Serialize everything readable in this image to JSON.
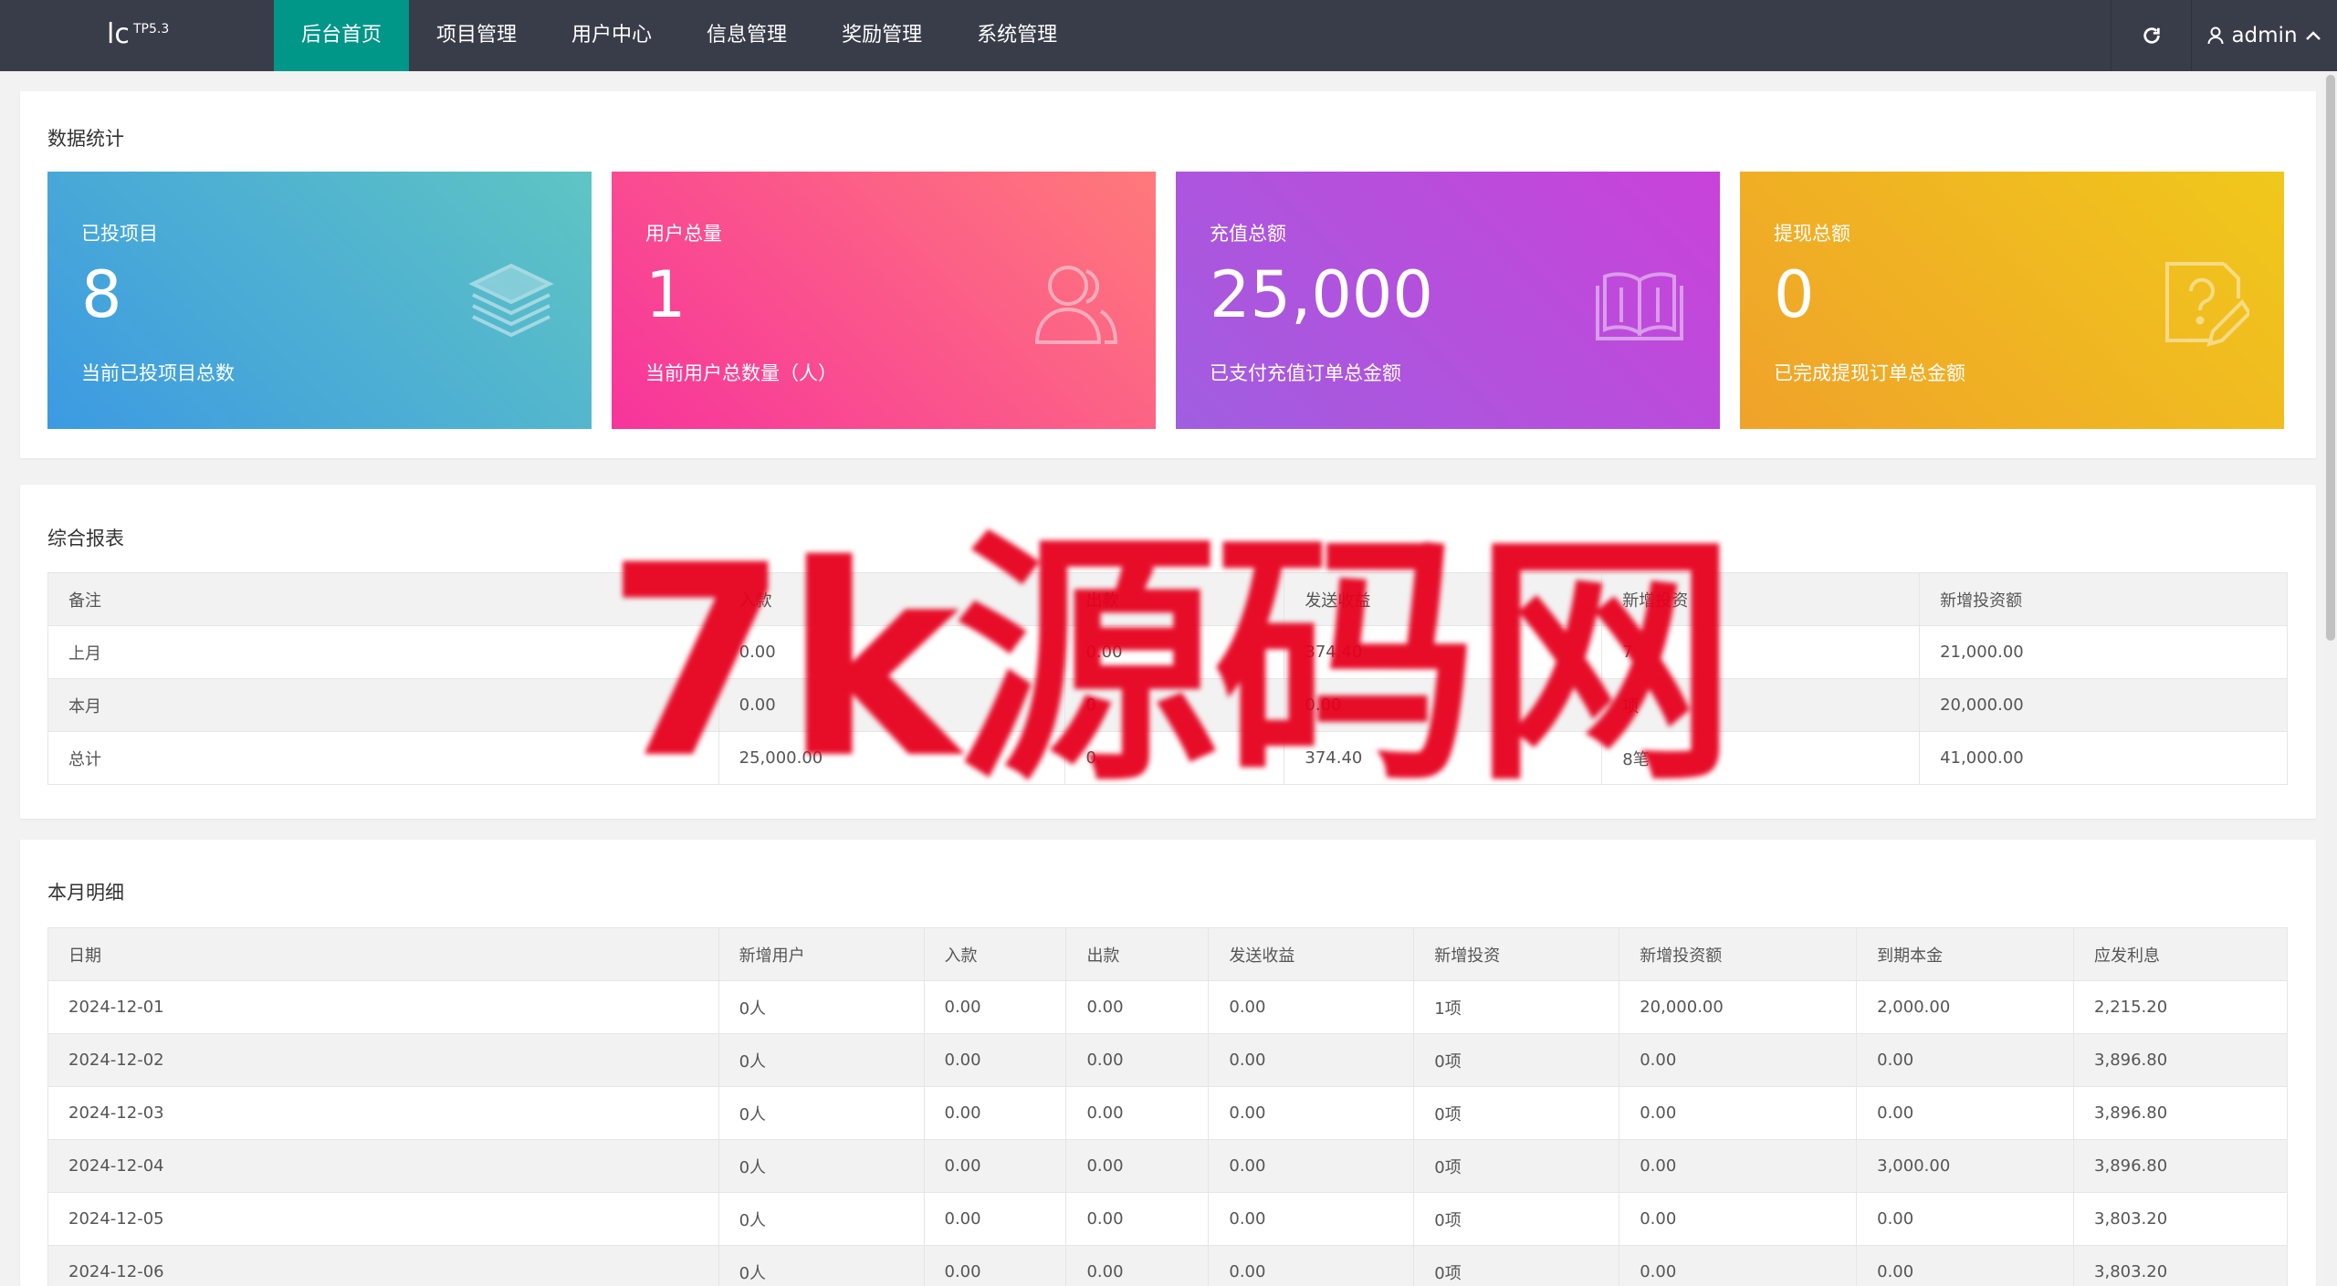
{
  "header": {
    "logo": "lc",
    "logo_sup": "TP5.3",
    "nav": [
      "后台首页",
      "项目管理",
      "用户中心",
      "信息管理",
      "奖励管理",
      "系统管理"
    ],
    "active_nav": 0,
    "refresh_icon": "refresh-icon",
    "user_icon": "user-icon",
    "username": "admin",
    "chevron_icon": "chevron-up-icon"
  },
  "stats": {
    "title": "数据统计",
    "tiles": [
      {
        "label": "已投项目",
        "value": "8",
        "desc": "当前已投项目总数",
        "icon": "layers-icon",
        "gradient": [
          "#3c9ae2",
          "#5fc5c3"
        ]
      },
      {
        "label": "用户总量",
        "value": "1",
        "desc": "当前用户总数量（人）",
        "icon": "users-icon",
        "gradient": [
          "#f7349c",
          "#ff7a7a"
        ]
      },
      {
        "label": "充值总额",
        "value": "25,000",
        "desc": "已支付充值订单总金额",
        "icon": "book-icon",
        "gradient": [
          "#a05ee0",
          "#c942d9"
        ]
      },
      {
        "label": "提现总额",
        "value": "0",
        "desc": "已完成提现订单总金额",
        "icon": "question-edit-icon",
        "gradient": [
          "#f0a22a",
          "#f0c81b"
        ]
      }
    ]
  },
  "report": {
    "title": "综合报表",
    "columns": [
      "备注",
      "入款",
      "出款",
      "发送收益",
      "新增投资",
      "新增投资额"
    ],
    "rows": [
      [
        "上月",
        "0.00",
        "0.00",
        "374.40",
        "7",
        "21,000.00"
      ],
      [
        "本月",
        "0.00",
        "0",
        "0.00",
        "项",
        "20,000.00"
      ],
      [
        "总计",
        "25,000.00",
        "0.",
        "374.40",
        "8笔",
        "41,000.00"
      ]
    ]
  },
  "monthly": {
    "title": "本月明细",
    "columns": [
      "日期",
      "新增用户",
      "入款",
      "出款",
      "发送收益",
      "新增投资",
      "新增投资额",
      "到期本金",
      "应发利息"
    ],
    "rows": [
      [
        "2024-12-01",
        "0人",
        "0.00",
        "0.00",
        "0.00",
        "1项",
        "20,000.00",
        "2,000.00",
        "2,215.20"
      ],
      [
        "2024-12-02",
        "0人",
        "0.00",
        "0.00",
        "0.00",
        "0项",
        "0.00",
        "0.00",
        "3,896.80"
      ],
      [
        "2024-12-03",
        "0人",
        "0.00",
        "0.00",
        "0.00",
        "0项",
        "0.00",
        "0.00",
        "3,896.80"
      ],
      [
        "2024-12-04",
        "0人",
        "0.00",
        "0.00",
        "0.00",
        "0项",
        "0.00",
        "3,000.00",
        "3,896.80"
      ],
      [
        "2024-12-05",
        "0人",
        "0.00",
        "0.00",
        "0.00",
        "0项",
        "0.00",
        "0.00",
        "3,803.20"
      ],
      [
        "2024-12-06",
        "0人",
        "0.00",
        "0.00",
        "0.00",
        "0项",
        "0.00",
        "0.00",
        "3,803.20"
      ]
    ]
  },
  "watermark": "7k源码网"
}
